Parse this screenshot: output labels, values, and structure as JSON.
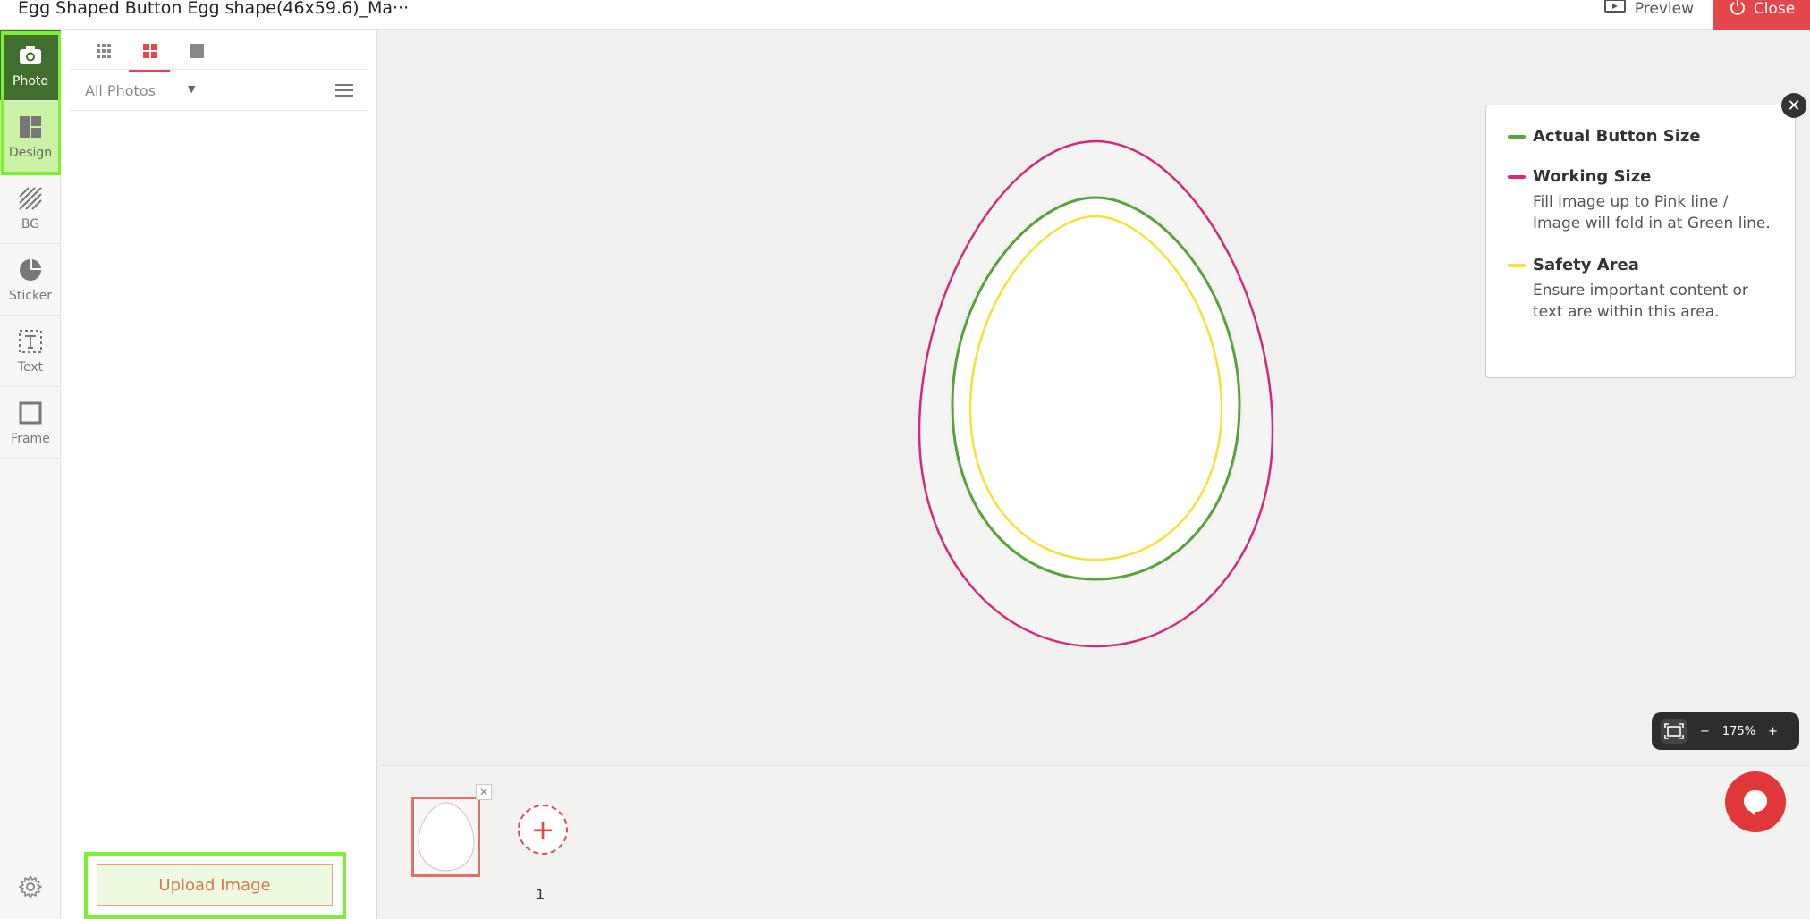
{
  "header": {
    "title": "Egg Shaped Button Egg shape(46x59.6)_Ma···",
    "preview_label": "Preview",
    "close_label": "Close"
  },
  "toolbar": {
    "items": [
      {
        "label": "Photo",
        "icon": "camera-icon"
      },
      {
        "label": "Design",
        "icon": "layout-icon"
      },
      {
        "label": "BG",
        "icon": "hatch-icon"
      },
      {
        "label": "Sticker",
        "icon": "sticker-icon"
      },
      {
        "label": "Text",
        "icon": "text-box-icon"
      },
      {
        "label": "Frame",
        "icon": "frame-icon"
      }
    ],
    "settings_icon": "gear-icon"
  },
  "panel": {
    "view_tabs": [
      "small-grid-icon",
      "medium-grid-icon",
      "large-tile-icon"
    ],
    "active_view_tab": 1,
    "filter_label": "All Photos",
    "upload_label": "Upload Image"
  },
  "legend": {
    "items": [
      {
        "title": "Actual Button Size",
        "desc": "",
        "color": "#5aa13c"
      },
      {
        "title": "Working Size",
        "desc": "Fill image up to Pink line / Image will fold in at Green line.",
        "color": "#d4287a"
      },
      {
        "title": "Safety Area",
        "desc": "Ensure important content or text are within this area.",
        "color": "#f5e13a"
      }
    ]
  },
  "zoom": {
    "level": "175%",
    "minus": "−",
    "plus": "+"
  },
  "pages": {
    "add_symbol": "+",
    "page_number": "1"
  },
  "colors": {
    "accent": "#e4474b",
    "photo_active": "#3f6e2f",
    "highlight": "#7df034"
  }
}
